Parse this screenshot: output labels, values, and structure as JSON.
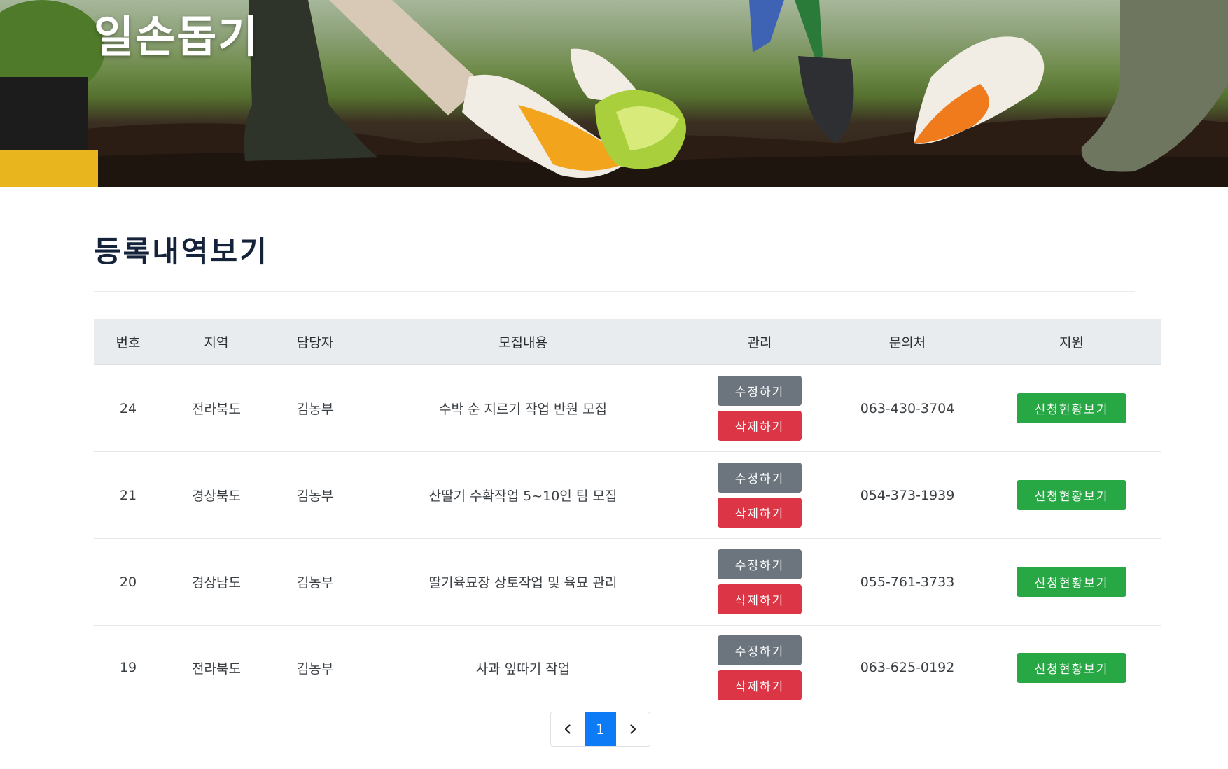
{
  "hero": {
    "title": "일손돕기"
  },
  "page": {
    "title": "등록내역보기"
  },
  "table": {
    "headers": {
      "no": "번호",
      "region": "지역",
      "manager": "담당자",
      "content": "모집내용",
      "manage": "관리",
      "contact": "문의처",
      "apply": "지원"
    },
    "edit_label": "수정하기",
    "delete_label": "삭제하기",
    "view_label": "신청현황보기",
    "rows": [
      {
        "no": "24",
        "region": "전라북도",
        "manager": "김농부",
        "content": "수박 순 지르기 작업 반원 모집",
        "contact": "063-430-3704"
      },
      {
        "no": "21",
        "region": "경상북도",
        "manager": "김농부",
        "content": "산딸기 수확작업 5~10인 팀 모집",
        "contact": "054-373-1939"
      },
      {
        "no": "20",
        "region": "경상남도",
        "manager": "김농부",
        "content": "딸기육묘장 상토작업 및 육묘 관리",
        "contact": "055-761-3733"
      },
      {
        "no": "19",
        "region": "전라북도",
        "manager": "김농부",
        "content": "사과 잎따기 작업",
        "contact": "063-625-0192"
      }
    ]
  },
  "pagination": {
    "prev_icon": "chevron-left-icon",
    "current": "1",
    "next_icon": "chevron-right-icon"
  },
  "colors": {
    "edit": "#6c757d",
    "delete": "#dc3545",
    "view": "#28a745",
    "active_page": "#0d7bf5",
    "header_bg": "#e9ecef"
  }
}
